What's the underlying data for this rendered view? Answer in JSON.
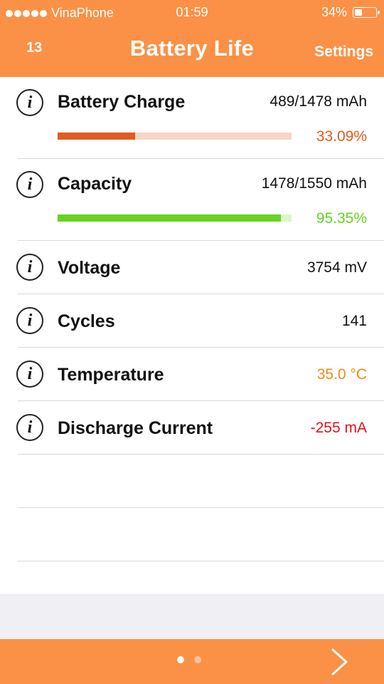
{
  "status_bar": {
    "carrier": "VinaPhone",
    "time": "01:59",
    "battery_percent": "34%",
    "battery_level": 0.34
  },
  "nav": {
    "left": "13",
    "title": "Battery Life",
    "right": "Settings"
  },
  "items": [
    {
      "label": "Battery Charge",
      "value": "489/1478 mAh",
      "percent": "33.09%",
      "fraction": 0.3309,
      "fill_color": "#e25a1f",
      "track_color": "#f6d5c6",
      "percent_color": "#e25a1f"
    },
    {
      "label": "Capacity",
      "value": "1478/1550 mAh",
      "percent": "95.35%",
      "fraction": 0.9535,
      "fill_color": "#66d321",
      "track_color": "#dcf5cc",
      "percent_color": "#66d321"
    },
    {
      "label": "Voltage",
      "value": "3754 mV",
      "value_color": "#111111"
    },
    {
      "label": "Cycles",
      "value": "141",
      "value_color": "#111111"
    },
    {
      "label": "Temperature",
      "value": "35.0 °C",
      "value_color": "#f08a12"
    },
    {
      "label": "Discharge Current",
      "value": "-255 mA",
      "value_color": "#e8101a"
    }
  ],
  "pager": {
    "pages": 2,
    "current": 1,
    "active_color": "#ffffff",
    "inactive_color": "#fcc49b"
  },
  "colors": {
    "accent": "#fa9146",
    "background": "#ffffff",
    "band": "#efeff4"
  },
  "icons": {
    "info": "info-circle-icon",
    "next": "chevron-right-icon"
  }
}
